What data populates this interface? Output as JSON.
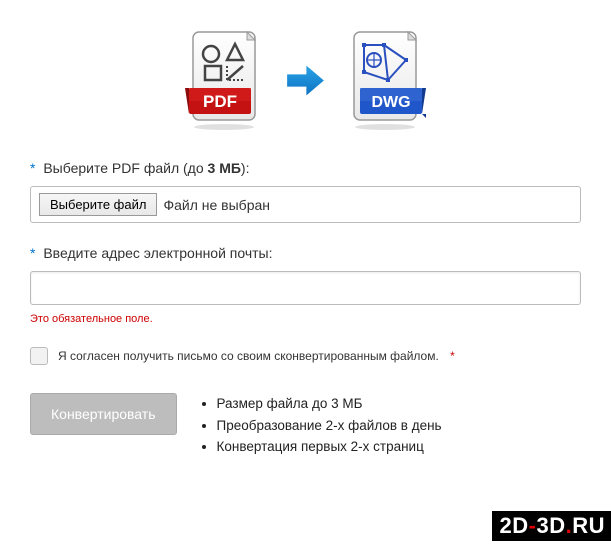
{
  "hero": {
    "source_label": "PDF",
    "target_label": "DWG"
  },
  "file_field": {
    "label_prefix": "Выберите PDF файл (до ",
    "label_bold": "3 МБ",
    "label_suffix": "):",
    "button_label": "Выберите файл",
    "status_text": "Файл не выбран"
  },
  "email_field": {
    "label": "Введите адрес электронной почты:",
    "value": "",
    "error": "Это обязательное поле."
  },
  "consent": {
    "text": "Я согласен получить письмо со своим сконвертированным файлом.",
    "required_mark": "*"
  },
  "submit": {
    "label": "Конвертировать"
  },
  "notes": [
    "Размер файла до 3 МБ",
    "Преобразование 2-х файлов в день",
    "Конвертация первых 2-х страниц"
  ],
  "watermark": {
    "part1": "2D",
    "dash": "-",
    "part2": "3D",
    "dot": ".",
    "part3": "RU"
  }
}
